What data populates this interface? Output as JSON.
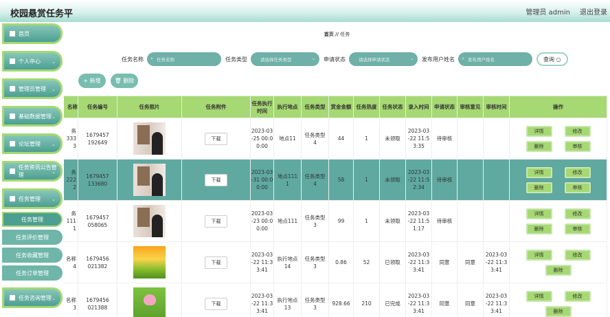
{
  "header": {
    "title": "校园悬赏任务平",
    "user": "管理员 admin",
    "logout": "退出登录"
  },
  "sidebar": {
    "menus": [
      {
        "label": "首页",
        "icon": "home-icon"
      },
      {
        "label": "个人中心",
        "icon": "user-icon"
      },
      {
        "label": "管理员管理",
        "icon": "admin-icon"
      },
      {
        "label": "基础数据管理",
        "icon": "grid-icon"
      },
      {
        "label": "论坛管理",
        "icon": "forum-icon"
      },
      {
        "label": "任务资讯公告管理",
        "icon": "list-icon"
      },
      {
        "label": "任务管理",
        "icon": "list-icon"
      },
      {
        "label": "任务咨询管理",
        "icon": "calendar-icon"
      }
    ],
    "subs": [
      "任务管理",
      "任务评价管理",
      "任务收藏管理",
      "任务订单管理"
    ]
  },
  "breadcrumb": {
    "home": "首页",
    "sep": "//",
    "current": "任务"
  },
  "search": {
    "name_label": "任务名称",
    "name_ph": "任务名称",
    "type_label": "任务类型",
    "type_ph": "请选择任务类型",
    "status_label": "申请状态",
    "status_ph": "请选择申请状态",
    "user_label": "发布用户姓名",
    "user_ph": "发布用户姓名",
    "query": "查询"
  },
  "actions": {
    "add": "+ 新增",
    "delete": "删除"
  },
  "table": {
    "headers": [
      "名称",
      "任务编号",
      "任务照片",
      "任务附件",
      "任务执行时间",
      "执行地点",
      "任务类型",
      "赏金金额",
      "任务热度",
      "任务状态",
      "录入时间",
      "申请状态",
      "审核意见",
      "审核时间",
      "操作"
    ],
    "download": "下载",
    "op": {
      "detail": "详情",
      "edit": "修改",
      "del": "删除",
      "audit": "审核"
    },
    "rows": [
      {
        "name": "务333\n3",
        "no": "1679457\n192649",
        "photo": "man",
        "time": "2023-03\n-25 00:0\n0:00",
        "place": "地点11",
        "type": "任务类型\n4",
        "amount": "44",
        "heat": "1",
        "status": "未领取",
        "created": "2023-03\n-22 11:5\n3:35",
        "apply": "待审核",
        "opinion": "",
        "atime": "",
        "full": true
      },
      {
        "name": "务222\n2",
        "no": "1679457\n133680",
        "photo": "man",
        "time": "2023-03\n-31 00:0\n0:00",
        "place": "地点111\n1",
        "type": "任务类型\n4",
        "amount": "58",
        "heat": "1",
        "status": "未领取",
        "created": "2023-03\n-22 11:5\n2:34",
        "apply": "待审核",
        "opinion": "",
        "atime": "",
        "full": true
      },
      {
        "name": "务111\n1",
        "no": "1679457\n058065",
        "photo": "man",
        "time": "2023-03\n-23 00:0\n0:00",
        "place": "地点111",
        "type": "任务类型\n3",
        "amount": "99",
        "heat": "1",
        "status": "未领取",
        "created": "2023-03\n-22 11:5\n1:17",
        "apply": "待审核",
        "opinion": "",
        "atime": "",
        "full": true
      },
      {
        "name": "名称\n4",
        "no": "1679456\n021382",
        "photo": "sun",
        "time": "2023-03\n-22 11:3\n3:41",
        "place": "执行地点\n14",
        "type": "任务类型\n3",
        "amount": "0.86",
        "heat": "52",
        "status": "已领取",
        "created": "2023-03\n-22 11:3\n3:41",
        "apply": "同意",
        "opinion": "同意",
        "atime": "2023-03\n-22 11:3\n3:41",
        "full": false
      },
      {
        "name": "名称\n3",
        "no": "1679456\n021388",
        "photo": "lotus",
        "time": "2023-03\n-22 11:3\n3:41",
        "place": "执行地点\n13",
        "type": "任务类型\n3",
        "amount": "928.66",
        "heat": "210",
        "status": "已完成",
        "created": "2023-03\n-22 11:3\n3:41",
        "apply": "同意",
        "opinion": "同意",
        "atime": "2023-03\n-22 11:3\n3:41",
        "full": false
      }
    ]
  }
}
